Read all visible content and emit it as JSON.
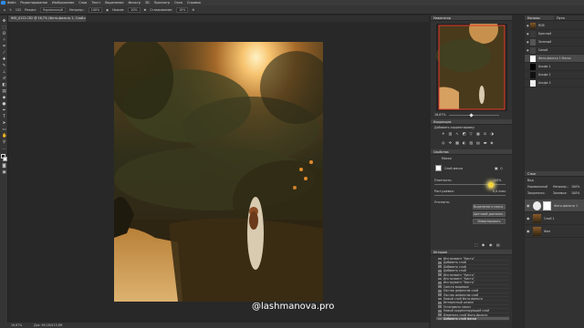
{
  "menu": [
    "Файл",
    "Редактирование",
    "Изображение",
    "Слои",
    "Текст",
    "Выделение",
    "Фильтр",
    "3D",
    "Просмотр",
    "Окно",
    "Справка"
  ],
  "options_bar": {
    "brush_size": "152",
    "mode_label": "Режим:",
    "mode_value": "Нормальный",
    "opacity_label": "Непрозр.:",
    "opacity_value": "100%",
    "flow_label": "Нажим:",
    "flow_value": "10%",
    "smoothing_label": "Сглаживание:",
    "smoothing_value": "10%"
  },
  "document_tab": "IMG_0122.CR2 @ 16,7% (Фото-фильтр 1, Слой-маска/16*)",
  "status": {
    "zoom": "16,67%",
    "doc_info": "Док: 69,1M/415,8M"
  },
  "watermark": "@lashmanova.pro",
  "navigator": {
    "title": "Навигатор",
    "zoom": "16,67%"
  },
  "adjustments": {
    "title": "Коррекция",
    "subtitle": "Добавить корректировку"
  },
  "properties": {
    "title": "Свойства",
    "section": "Маски",
    "mask_label": "Слой-маска",
    "density_label": "Плотность:",
    "density_value": "100%",
    "feather_label": "Растушевка:",
    "feather_value": "0,0 пикс",
    "refine_label": "Уточнить:",
    "btn_select_mask": "Выделение и маска...",
    "btn_color_range": "Цветовой диапазон...",
    "btn_invert": "Инвертировать"
  },
  "history": {
    "title": "История",
    "items": [
      "Инструмент \"Кисть\"",
      "Добавить слой",
      "Добавить слой",
      "Добавить слой",
      "Инструмент \"Кисть\"",
      "Инструмент \"Кисть\"",
      "Инструмент \"Кисть\"",
      "Свести видимые",
      "Ластик дефектов слой",
      "Ластик дефектов слой",
      "Новый слой Фото-фильтр",
      "Интересный штамп",
      "Установить маску",
      "Новый корректирующий слой",
      "Изменить слой Фото-фильтр",
      "Добавить слой маски"
    ]
  },
  "channels": {
    "tabs": [
      "Каналы",
      "Пути"
    ],
    "rows": [
      "RGB",
      "Красный",
      "Зеленый",
      "Синий",
      "Фото-фильтр 1 Маска",
      "Альфа 1",
      "Альфа 2",
      "Альфа 3"
    ]
  },
  "layers": {
    "title": "Слои",
    "kind_label": "Вид",
    "blend_mode": "Нормальный",
    "opacity_label": "Непрозр.:",
    "opacity_value": "100%",
    "lock_label": "Закрепить:",
    "fill_label": "Заливка:",
    "fill_value": "100%",
    "rows": [
      "Фото-фильтр 1",
      "Слой 1",
      "Фон"
    ]
  },
  "colors": {
    "accent": "#2d8ceb",
    "bg": "#282828",
    "panel": "#323232"
  }
}
